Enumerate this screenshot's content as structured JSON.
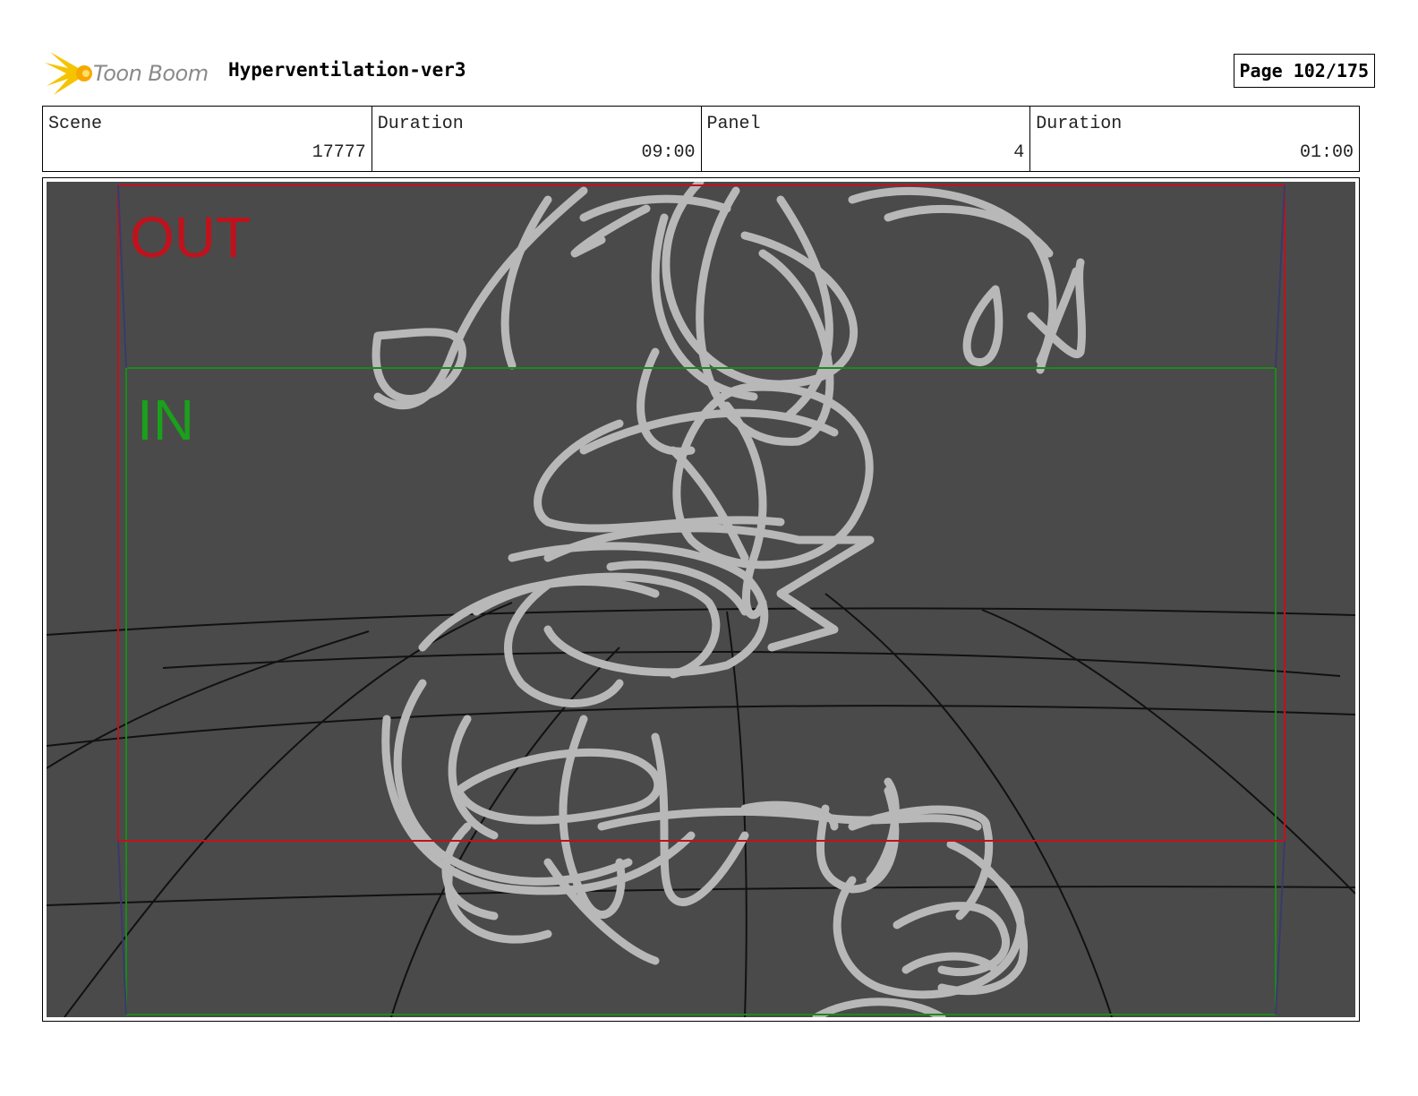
{
  "header": {
    "logo_text": "Toon Boom",
    "project_title": "Hyperventilation-ver3",
    "page_label": "Page 102/175"
  },
  "info": {
    "scene_label": "Scene",
    "scene_value": "17777",
    "duration_label": "Duration",
    "duration_value": "09:00",
    "panel_label": "Panel",
    "panel_value": "4",
    "panel_duration_label": "Duration",
    "panel_duration_value": "01:00"
  },
  "panel": {
    "out_label": "OUT",
    "in_label": "IN",
    "colors": {
      "background": "#4a4a4a",
      "out_frame": "#c0121c",
      "in_frame": "#1a8a1a",
      "sketch": "#b8b8b8",
      "grid": "#111111"
    }
  }
}
